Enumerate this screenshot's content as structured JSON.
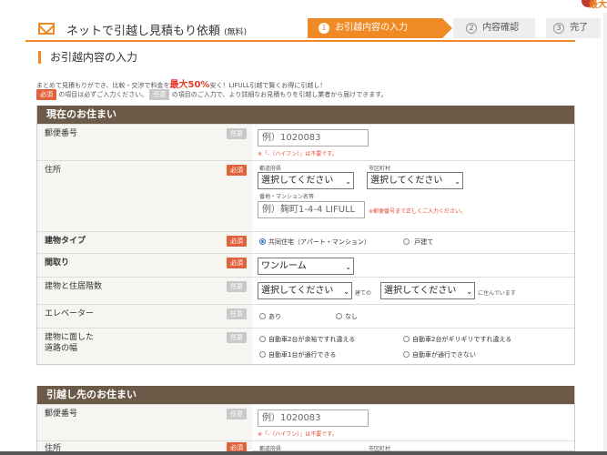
{
  "corner_text": "最大",
  "header": {
    "title": "ネットで引越し見積もり依頼",
    "title_small": "(無料)",
    "steps": [
      {
        "num": "1",
        "label": "お引越内容の入力"
      },
      {
        "num": "2",
        "label": "内容確認"
      },
      {
        "num": "3",
        "label": "完了"
      }
    ]
  },
  "section_title": "お引越内容の入力",
  "notes": {
    "line1_pre": "まとめて見積もりができ、比較・交渉で料金を",
    "line1_highlight": "最大50%",
    "line1_post": "安く！LIFULL引越で賢くお得に引越し！",
    "required_badge": "必須",
    "line2_mid": "の項目は必ずご入力ください。",
    "optional_badge": "任意",
    "line2_post": "の項目のご入力で、より詳細なお見積もりを引越し業者から届けできます。"
  },
  "current": {
    "heading": "現在のお住まい",
    "postal": {
      "label": "郵便番号",
      "badge": "任意",
      "placeholder": "例）1020083",
      "hint": "※「-（ハイフン）」は不要です。"
    },
    "address": {
      "label": "住所",
      "badge": "必須",
      "pref_label": "都道府県",
      "pref_value": "選択してください",
      "city_label": "市区町村",
      "city_value": "選択してください",
      "street_label": "番地・マンション名等",
      "street_placeholder": "例）麹町1-4-4 LIFULL",
      "street_hint": "※郵便番号まで正しくご入力ください。"
    },
    "building": {
      "label": "建物タイプ",
      "badge": "必須",
      "opt1": "共同住宅（アパート・マンション）",
      "opt2": "戸建て"
    },
    "layout": {
      "label": "間取り",
      "badge": "必須",
      "value": "ワンルーム"
    },
    "floors": {
      "label": "建物と住居階数",
      "badge": "任意",
      "value1": "選択してください",
      "mid": "建ての",
      "value2": "選択してください",
      "post": "に住んでいます"
    },
    "elevator": {
      "label": "エレベーター",
      "badge": "任意",
      "opt1": "あり",
      "opt2": "なし"
    },
    "road": {
      "label_line1": "建物に面した",
      "label_line2": "道路の幅",
      "badge": "任意",
      "opt1": "自動車2台が余裕ですれ違える",
      "opt2": "自動車2台がギリギリですれ違える",
      "opt3": "自動車1台が通行できる",
      "opt4": "自動車が通行できない"
    }
  },
  "destination": {
    "heading": "引越し先のお住まい",
    "postal": {
      "label": "郵便番号",
      "badge": "任意",
      "placeholder": "例）1020083",
      "hint": "※「-（ハイフン）」は不要です。"
    },
    "address": {
      "label": "住所",
      "badge": "必須",
      "pref_label": "都道府県",
      "city_label": "市区町村"
    }
  }
}
